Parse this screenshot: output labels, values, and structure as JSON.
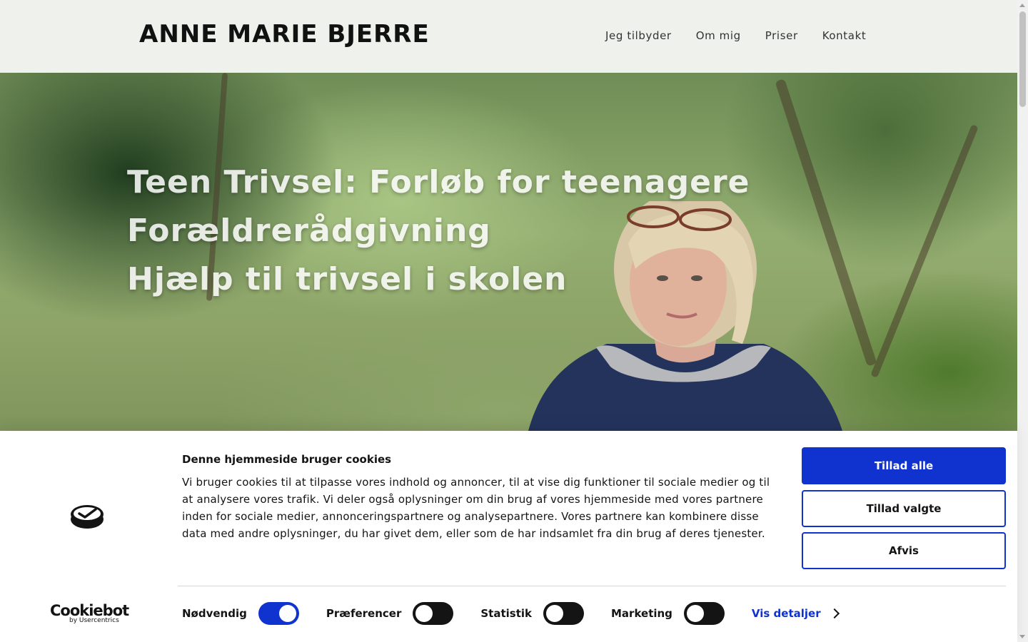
{
  "header": {
    "brand": "ANNE MARIE BJERRE",
    "nav": [
      "Jeg tilbyder",
      "Om mig",
      "Priser",
      "Kontakt"
    ]
  },
  "hero": {
    "lines": [
      "Teen Trivsel: Forløb for teenagere",
      "Forældrerådgivning",
      "Hjælp til trivsel i skolen"
    ]
  },
  "cookie": {
    "title": "Denne hjemmeside bruger cookies",
    "body": "Vi bruger cookies til at tilpasse vores indhold og annoncer, til at vise dig funktioner til sociale medier og til at analysere vores trafik. Vi deler også oplysninger om din brug af vores hjemmeside med vores partnere inden for sociale medier, annonceringspartnere og analysepartnere. Vores partnere kan kombinere disse data med andre oplysninger, du har givet dem, eller som de har indsamlet fra din brug af deres tjenester.",
    "buttons": {
      "allow_all": "Tillad alle",
      "allow_selected": "Tillad valgte",
      "deny": "Afvis"
    },
    "toggles": [
      {
        "label": "Nødvendig",
        "on": true
      },
      {
        "label": "Præferencer",
        "on": false
      },
      {
        "label": "Statistik",
        "on": false
      },
      {
        "label": "Marketing",
        "on": false
      }
    ],
    "details_link": "Vis detaljer",
    "vendor": {
      "name": "Cookiebot",
      "sub": "by Usercentrics"
    }
  },
  "colors": {
    "accent": "#1032cf",
    "header_bg": "#eff1ec"
  }
}
